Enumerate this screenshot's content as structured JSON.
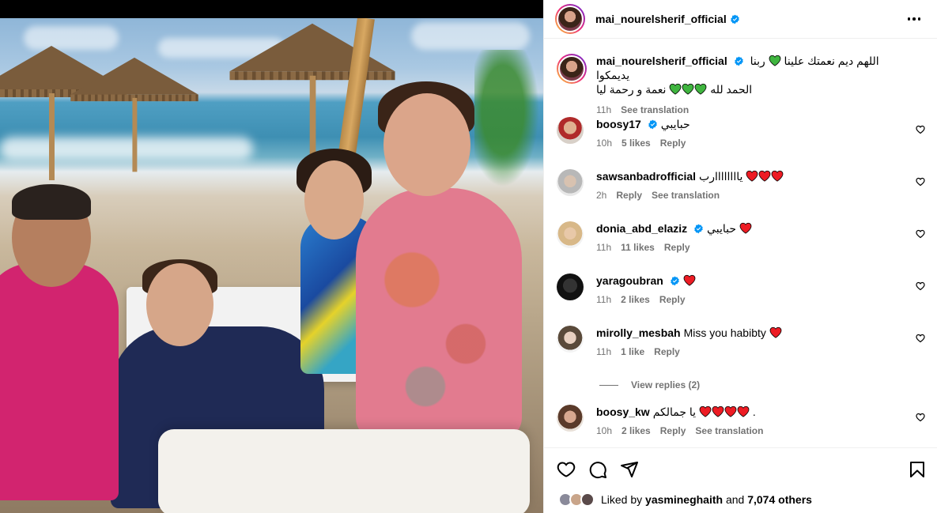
{
  "post": {
    "author": "mai_nourelsherif_official",
    "caption_line1": "اللهم ديم نعمتك علينا",
    "caption_line1b": "ربنا يديمكوا",
    "caption_line2": "نعمة و رحمة ليا",
    "caption_line2b": "الحمد لله",
    "caption_time": "11h",
    "see_translation": "See translation"
  },
  "comments": [
    {
      "user": "boosy17",
      "verified": true,
      "text": "حبايبي",
      "hearts": [],
      "time": "10h",
      "likes": "5 likes",
      "reply": "Reply",
      "translate": ""
    },
    {
      "user": "sawsanbadrofficial",
      "verified": false,
      "text": "ياااااااارب",
      "hearts": [
        "red",
        "red",
        "red"
      ],
      "time": "2h",
      "likes": "",
      "reply": "Reply",
      "translate": "See translation"
    },
    {
      "user": "donia_abd_elaziz",
      "verified": true,
      "text": "حبايبي",
      "hearts": [
        "red"
      ],
      "time": "11h",
      "likes": "11 likes",
      "reply": "Reply",
      "translate": ""
    },
    {
      "user": "yaragoubran",
      "verified": true,
      "text": "",
      "hearts": [
        "red"
      ],
      "time": "11h",
      "likes": "2 likes",
      "reply": "Reply",
      "translate": ""
    },
    {
      "user": "mirolly_mesbah",
      "verified": false,
      "text": "Miss you habibty",
      "hearts": [
        "red"
      ],
      "time": "11h",
      "likes": "1 like",
      "reply": "Reply",
      "translate": ""
    },
    {
      "user": "boosy_kw",
      "verified": false,
      "text": "يا جمالكم",
      "prefix": ".",
      "hearts": [
        "red",
        "red",
        "red",
        "red"
      ],
      "time": "10h",
      "likes": "2 likes",
      "reply": "Reply",
      "translate": "See translation"
    }
  ],
  "view_replies": "View replies (2)",
  "liked_by": {
    "prefix": "Liked by",
    "user": "yasmineghaith",
    "and": "and",
    "others": "7,074 others"
  },
  "colors": {
    "verified": "#0095f6",
    "heart_red": "#ed1c24",
    "heart_green": "#3fb53f",
    "meta": "#737373"
  },
  "icons": [
    "heart-icon",
    "comment-icon",
    "share-icon",
    "bookmark-icon",
    "more-icon",
    "verified-icon"
  ]
}
